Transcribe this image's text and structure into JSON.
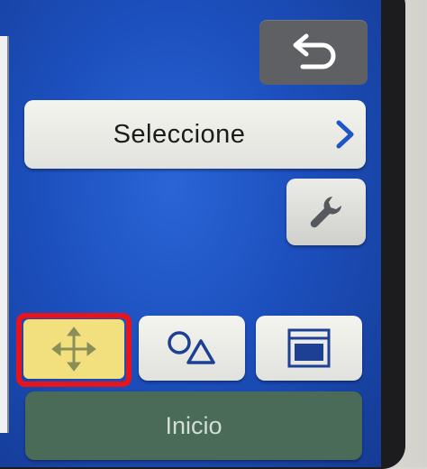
{
  "header": {
    "back_icon": "back-arrow-icon"
  },
  "main": {
    "select_button": {
      "label": "Seleccione",
      "icon": "chevron-right-icon"
    },
    "tools_button": {
      "icon": "wrench-icon"
    },
    "edit_buttons": [
      {
        "icon": "move-arrows-icon",
        "selected": true
      },
      {
        "icon": "shapes-icon",
        "selected": false
      },
      {
        "icon": "frame-icon",
        "selected": false
      }
    ]
  },
  "footer": {
    "home_label": "Inicio"
  },
  "colors": {
    "screen": "#1c4fbd",
    "selected_button": "#f1e07d",
    "highlight": "#e8141c",
    "home_button": "#4a6b57",
    "chevron": "#1e56c8"
  }
}
